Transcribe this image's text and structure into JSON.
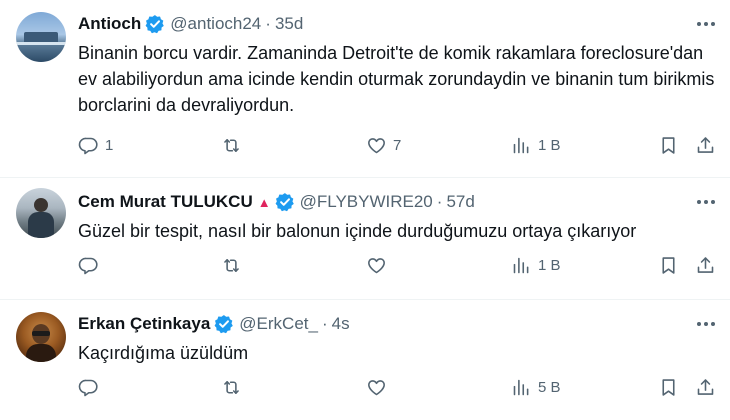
{
  "tweets": [
    {
      "name": "Antioch",
      "handle": "@antioch24",
      "age": "35d",
      "text": "Binanin borcu vardir. Zamaninda Detroit'te de komik rakamlara foreclosure'dan ev alabiliyordun ama icinde kendin oturmak zorundaydin ve binanin tum birikmis borclarini da devraliyordun.",
      "replies": "1",
      "retweets": "",
      "likes": "7",
      "views": "1 B"
    },
    {
      "name": "Cem Murat TULUKCU",
      "handle": "@FLYBYWIRE20",
      "age": "57d",
      "text": "Güzel bir tespit, nasıl bir balonun içinde durduğumuzu ortaya çıkarıyor",
      "replies": "",
      "retweets": "",
      "likes": "",
      "views": "1 B"
    },
    {
      "name": "Erkan Çetinkaya",
      "handle": "@ErkCet_",
      "age": "4s",
      "text": "Kaçırdığıma üzüldüm",
      "replies": "",
      "retweets": "",
      "likes": "",
      "views": "5 B"
    }
  ],
  "colors": {
    "verified": "#1d9bf0",
    "muted": "#536471",
    "text": "#0f1419",
    "triangle": "#e0245e"
  },
  "icons": [
    "reply-icon",
    "retweet-icon",
    "like-icon",
    "views-icon",
    "bookmark-icon",
    "share-icon",
    "verified-badge-icon",
    "more-icon"
  ]
}
